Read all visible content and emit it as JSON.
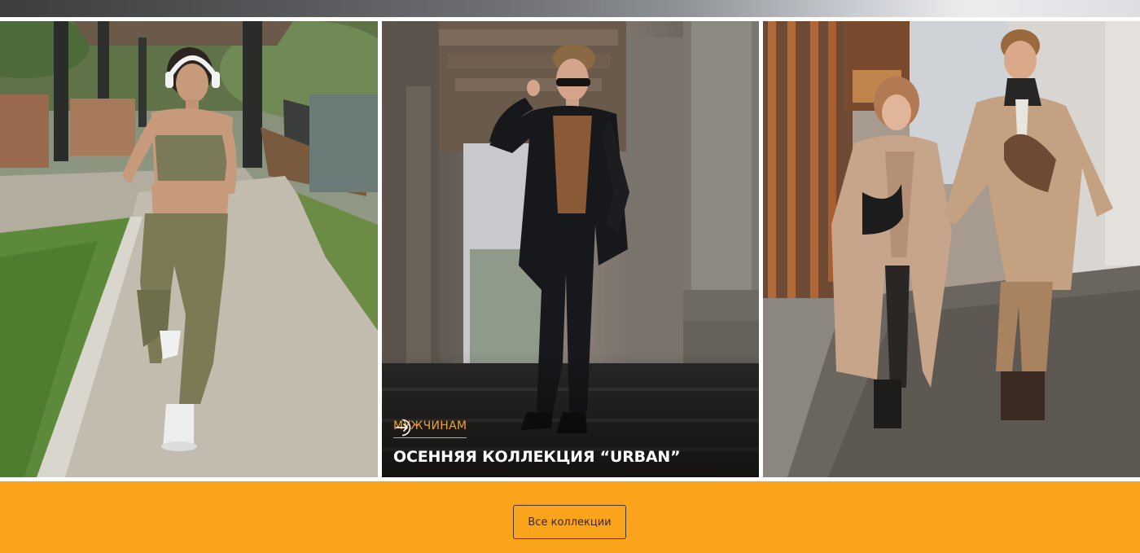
{
  "colors": {
    "accent": "#f2a21c",
    "band": "#fca31c",
    "button_border": "#4a3220",
    "title_text": "#ffffff"
  },
  "cards": [
    {
      "photo": "woman-jogging-photo"
    },
    {
      "photo": "man-in-suit-photo",
      "category": "МУЖЧИНАМ",
      "title": "ОСЕННЯЯ КОЛЛЕКЦИЯ “URBAN”",
      "icon": "enter-circle-arrow-icon"
    },
    {
      "photo": "couple-walking-photo"
    }
  ],
  "cta": {
    "all_collections_label": "Все коллекции"
  }
}
